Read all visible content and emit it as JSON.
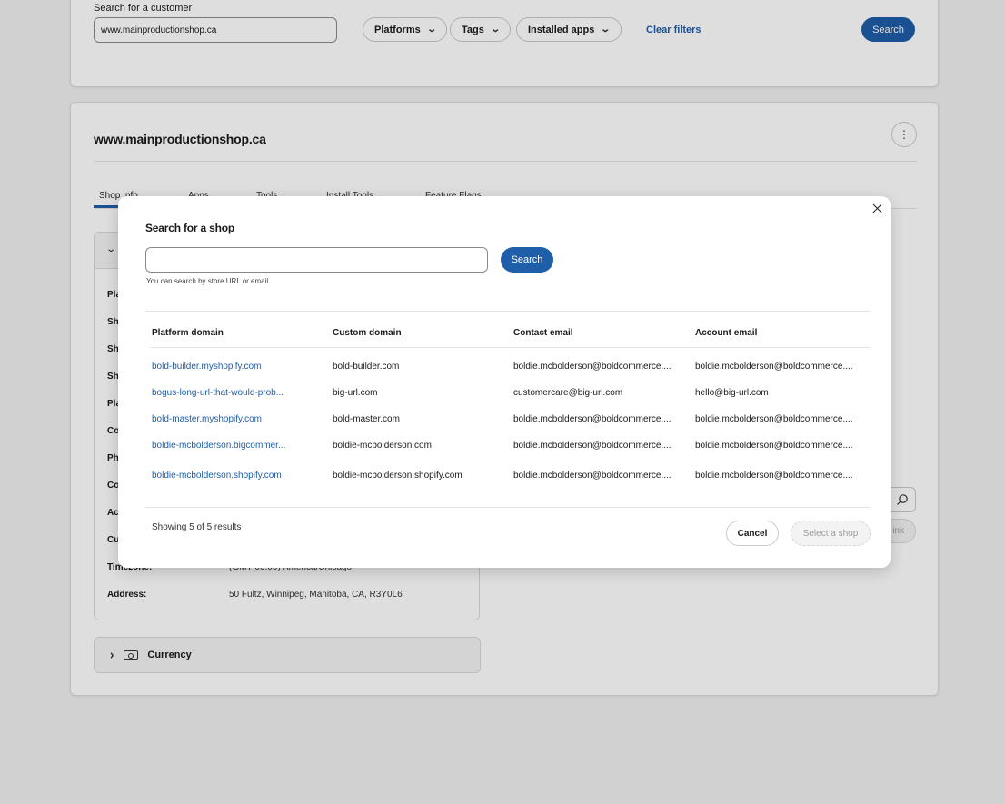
{
  "filters": {
    "search_label": "Search for a customer",
    "search_value": "www.mainproductionshop.ca",
    "platforms": "Platforms",
    "tags": "Tags",
    "installed_apps": "Installed apps",
    "clear_filters": "Clear filters",
    "search_button": "Search"
  },
  "shop": {
    "title": "www.mainproductionshop.ca",
    "tabs": [
      "Shop Info",
      "Apps",
      "Tools",
      "Install Tools",
      "Feature Flags"
    ],
    "fields": [
      {
        "label": "Pla",
        "value": ""
      },
      {
        "label": "Sh",
        "value": ""
      },
      {
        "label": "Sh",
        "value": ""
      },
      {
        "label": "Sh",
        "value": ""
      },
      {
        "label": "Pla",
        "value": ""
      },
      {
        "label": "Co",
        "value": ""
      },
      {
        "label": "Ph",
        "value": ""
      },
      {
        "label": "Co",
        "value": ""
      },
      {
        "label": "Ac",
        "value": ""
      },
      {
        "label": "Cu",
        "value": ""
      },
      {
        "label": "Timezone:",
        "value": "(GMT-06:00) America/Chicago"
      },
      {
        "label": "Address:",
        "value": "50 Fultz, Winnipeg, Manitoba, CA, R3Y0L6"
      }
    ],
    "currency_label": "Currency",
    "right_pill": "ink"
  },
  "modal": {
    "title": "Search for a shop",
    "input_value": "",
    "search_button": "Search",
    "hint": "You can search by store URL or email",
    "columns": [
      "Platform domain",
      "Custom domain",
      "Contact email",
      "Account email"
    ],
    "rows": [
      [
        "bold-builder.myshopify.com",
        "bold-builder.com",
        "boldie.mcbolderson@boldcommerce....",
        "boldie.mcbolderson@boldcommerce...."
      ],
      [
        "bogus-long-url-that-would-prob...",
        "big-url.com",
        "customercare@big-url.com",
        "hello@big-url.com"
      ],
      [
        "bold-master.myshopify.com",
        "bold-master.com",
        "boldie.mcbolderson@boldcommerce....",
        "boldie.mcbolderson@boldcommerce...."
      ],
      [
        "boldie-mcbolderson.bigcommer...",
        "boldie-mcbolderson.com",
        "boldie.mcbolderson@boldcommerce....",
        "boldie.mcbolderson@boldcommerce...."
      ],
      [
        "boldie-mcbolderson.shopify.com",
        "boldie-mcbolderson.shopify.com",
        "boldie.mcbolderson@boldcommerce....",
        "boldie.mcbolderson@boldcommerce...."
      ]
    ],
    "results_text": "Showing 5 of 5 results",
    "cancel": "Cancel",
    "select": "Select a shop"
  },
  "colors": {
    "accent": "#1f5ea8",
    "background": "#f1f1f1"
  }
}
